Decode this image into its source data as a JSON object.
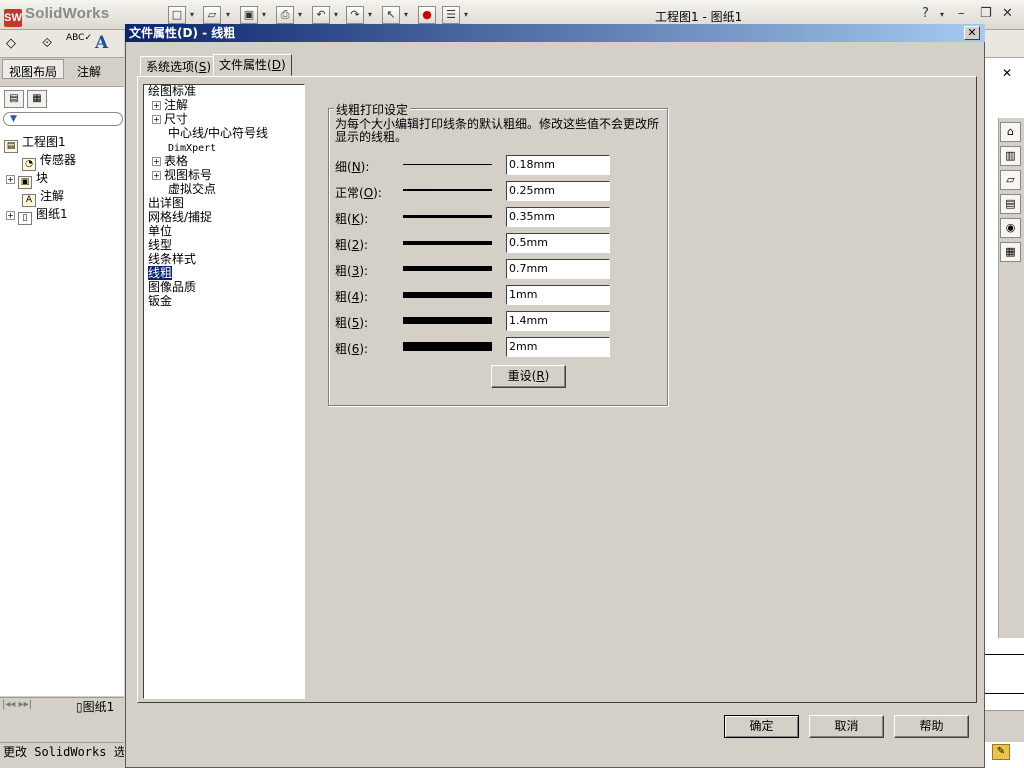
{
  "app": {
    "logo_text": "SolidWorks",
    "title": "工程图1 - 图纸1",
    "help_label": "?",
    "minimize_label": "–",
    "restore_label": "❐",
    "close_label": "✕"
  },
  "command_manager": {
    "tabs": [
      "视图布局",
      "注解"
    ]
  },
  "feature_tree": {
    "root": "工程图1",
    "nodes": [
      "传感器",
      "块",
      "注解",
      "图纸1"
    ],
    "sheet_tab": "图纸1"
  },
  "status_bar": {
    "text": "更改 SolidWorks 选项"
  },
  "dialog": {
    "title": "文件属性(D) - 线粗",
    "close_label": "✕",
    "tabs": [
      {
        "label": "系统选项(",
        "key": "S",
        "suffix": ")"
      },
      {
        "label": "文件属性(",
        "key": "D",
        "suffix": ")"
      }
    ],
    "nav": [
      {
        "label": "绘图标准",
        "level": 0
      },
      {
        "label": "注解",
        "level": 1,
        "expand": "+"
      },
      {
        "label": "尺寸",
        "level": 1,
        "expand": "+"
      },
      {
        "label": "中心线/中心符号线",
        "level": 2
      },
      {
        "label": "DimXpert",
        "level": 2
      },
      {
        "label": "表格",
        "level": 1,
        "expand": "+"
      },
      {
        "label": "视图标号",
        "level": 1,
        "expand": "+"
      },
      {
        "label": "虚拟交点",
        "level": 2
      },
      {
        "label": "出详图",
        "level": 0
      },
      {
        "label": "网格线/捕捉",
        "level": 0
      },
      {
        "label": "单位",
        "level": 0
      },
      {
        "label": "线型",
        "level": 0
      },
      {
        "label": "线条样式",
        "level": 0
      },
      {
        "label": "线粗",
        "level": 0,
        "selected": true
      },
      {
        "label": "图像品质",
        "level": 0
      },
      {
        "label": "钣金",
        "level": 0
      }
    ],
    "group_title": "线粗打印设定",
    "description": "为每个大小编辑打印线条的默认粗细。修改这些值不会更改所显示的线粗。",
    "weights": [
      {
        "label": "细(",
        "key": "N",
        "suffix": "):",
        "value": "0.18mm"
      },
      {
        "label": "正常(",
        "key": "O",
        "suffix": "):",
        "value": "0.25mm"
      },
      {
        "label": "粗(",
        "key": "K",
        "suffix": "):",
        "value": "0.35mm"
      },
      {
        "label": "粗(",
        "key": "2",
        "suffix": "):",
        "value": "0.5mm"
      },
      {
        "label": "粗(",
        "key": "3",
        "suffix": "):",
        "value": "0.7mm"
      },
      {
        "label": "粗(",
        "key": "4",
        "suffix": "):",
        "value": "1mm"
      },
      {
        "label": "粗(",
        "key": "5",
        "suffix": "):",
        "value": "1.4mm"
      },
      {
        "label": "粗(",
        "key": "6",
        "suffix": "):",
        "value": "2mm"
      }
    ],
    "reset_button": {
      "label": "重设(",
      "key": "R",
      "suffix": ")"
    },
    "ok_button": "确定",
    "cancel_button": "取消",
    "help_button": "帮助"
  }
}
